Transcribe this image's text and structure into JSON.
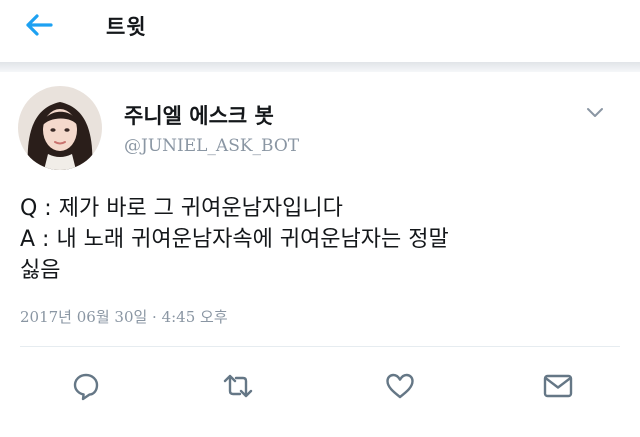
{
  "header": {
    "back_icon": "arrow-left-icon",
    "title": "트윗",
    "accent_color": "#1da1f2"
  },
  "tweet": {
    "author": {
      "display_name": "주니엘 에스크 봇",
      "handle": "@JUNIEL_ASK_BOT"
    },
    "lines": [
      "Q : 제가 바로 그 귀여운남자입니다",
      "A : 내 노래 귀여운남자속에 귀여운남자는 정말",
      "싫음"
    ],
    "timestamp": "2017년 06월 30일 · 4:45 오후",
    "actions": [
      "reply-icon",
      "retweet-icon",
      "like-icon",
      "direct-message-icon"
    ]
  },
  "colors": {
    "text": "#14171a",
    "muted": "#8a96a3",
    "divider": "#e6ecf0"
  }
}
